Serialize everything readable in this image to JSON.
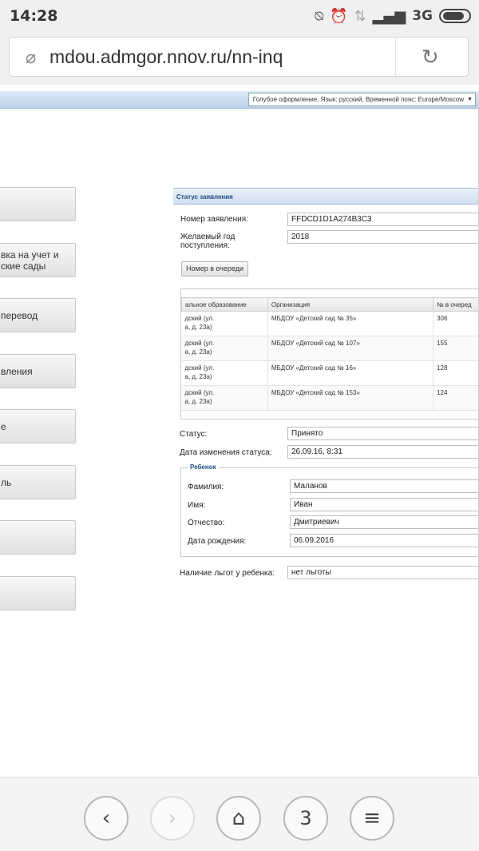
{
  "status_bar": {
    "time": "14:28",
    "network": "3G"
  },
  "browser": {
    "url": "mdou.admgor.nnov.ru/nn-inq"
  },
  "theme_bar": {
    "select_value": "Голубое оформление, Язык: русский, Временной пояс: Europe/Moscow"
  },
  "left_menu": {
    "items": [
      {
        "label": ""
      },
      {
        "label": "вка на учет и\nские сады"
      },
      {
        "label": "перевод"
      },
      {
        "label": "вления"
      },
      {
        "label": "е"
      },
      {
        "label": "ль"
      },
      {
        "label": ""
      },
      {
        "label": ""
      }
    ]
  },
  "application": {
    "panel_title": "Статус заявления",
    "number_label": "Номер заявления:",
    "number_value": "FFDCD1D1A274B3C3",
    "year_label": "Желаемый год поступления:",
    "year_value": "2018",
    "queue_button": "Номер в очереди",
    "table": {
      "headers": [
        "альное образование",
        "Организация",
        "№ в очеред"
      ],
      "rows": [
        {
          "district": "дский (ул.\nа, д. 23а)",
          "org": "МБДОУ «Детский сад № 35»",
          "num": "306"
        },
        {
          "district": "дский (ул.\nа, д. 23а)",
          "org": "МБДОУ «Детский сад № 107»",
          "num": "155"
        },
        {
          "district": "дский (ул.\nа, д. 23а)",
          "org": "МБДОУ «Детский сад № 16»",
          "num": "128"
        },
        {
          "district": "дский (ул.\nа, д. 23а)",
          "org": "МБДОУ «Детский сад № 153»",
          "num": "124"
        }
      ]
    },
    "status_label": "Статус:",
    "status_value": "Принято",
    "changed_label": "Дата изменения статуса:",
    "changed_value": "26.09.16, 8:31",
    "child": {
      "legend": "Ребенок",
      "surname_label": "Фамилия:",
      "surname_value": "Маланов",
      "name_label": "Имя:",
      "name_value": "Иван",
      "patronymic_label": "Отчество:",
      "patronymic_value": "Дмитриевич",
      "birth_label": "Дата рождения:",
      "birth_value": "06.09.2016"
    },
    "benefits_label": "Наличие льгот у ребенка:",
    "benefits_value": "нет льготы"
  },
  "nav": {
    "tabs_count": "3"
  }
}
